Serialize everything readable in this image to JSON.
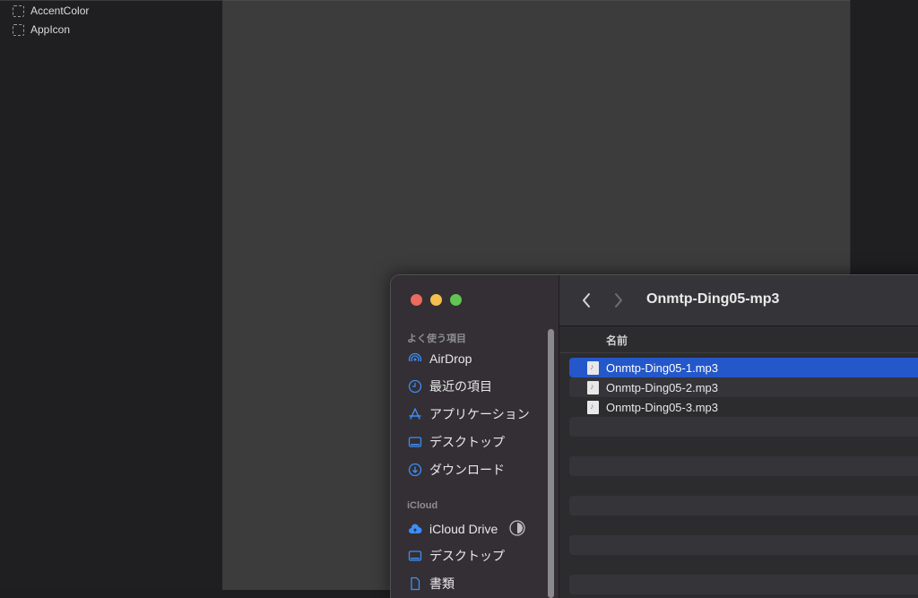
{
  "assets": {
    "items": [
      {
        "label": "AccentColor"
      },
      {
        "label": "AppIcon"
      }
    ]
  },
  "finder": {
    "title": "Onmtp-Ding05-mp3",
    "sidebar": {
      "favorites_title": "よく使う項目",
      "favorites": [
        {
          "label": "AirDrop",
          "icon": "airdrop-icon"
        },
        {
          "label": "最近の項目",
          "icon": "clock-icon"
        },
        {
          "label": "アプリケーション",
          "icon": "applications-icon"
        },
        {
          "label": "デスクトップ",
          "icon": "desktop-icon"
        },
        {
          "label": "ダウンロード",
          "icon": "download-icon"
        }
      ],
      "icloud_title": "iCloud",
      "icloud": [
        {
          "label": "iCloud Drive",
          "icon": "cloud-icon"
        },
        {
          "label": "デスクトップ",
          "icon": "desktop-icon"
        },
        {
          "label": "書類",
          "icon": "document-icon"
        }
      ]
    },
    "column_header": "名前",
    "files": [
      {
        "name": "Onmtp-Ding05-1.mp3",
        "selected": true
      },
      {
        "name": "Onmtp-Ding05-2.mp3",
        "selected": false
      },
      {
        "name": "Onmtp-Ding05-3.mp3",
        "selected": false
      }
    ],
    "colors": {
      "selection": "#2457c9",
      "accent_icon": "#3d8ef7",
      "close": "#ed6a5e",
      "minimize": "#f4bf4f",
      "maximize": "#61c554"
    }
  }
}
